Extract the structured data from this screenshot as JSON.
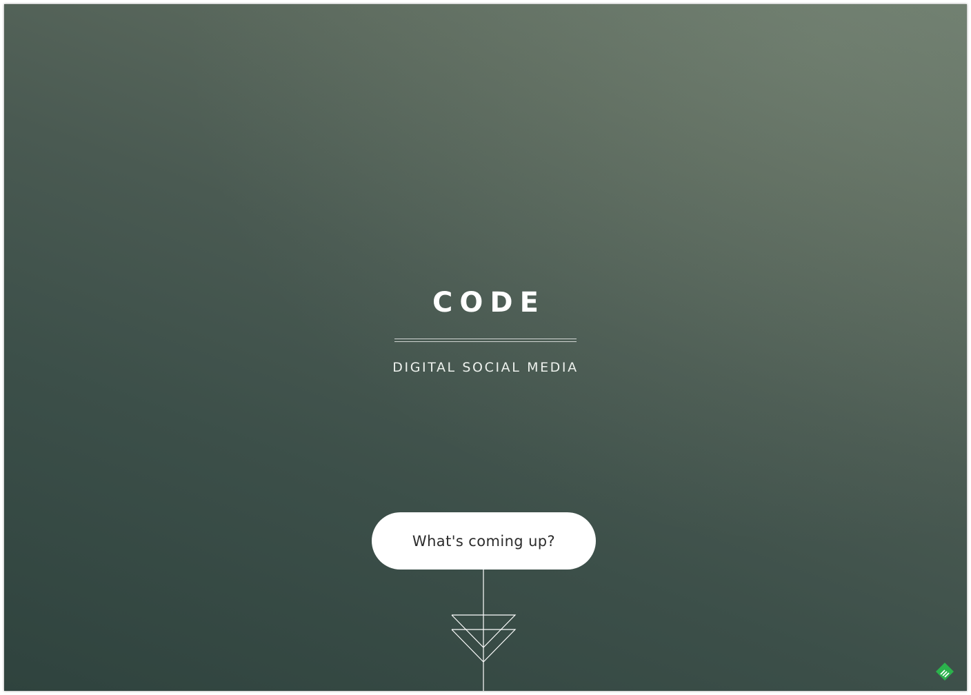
{
  "hero": {
    "title": "CODE",
    "subtitle": "DIGITAL SOCIAL MEDIA"
  },
  "cta": {
    "label": "What's coming up?"
  },
  "icons": {
    "scroll_arrow": "double-chevron-down-arrow-icon",
    "badge": "feedly-logo-icon"
  },
  "colors": {
    "background_top": "#6b7a6c",
    "background_bottom": "#2f433e",
    "button_bg": "#ffffff",
    "button_text": "#2b2b2b",
    "badge_green": "#2bb24c"
  }
}
